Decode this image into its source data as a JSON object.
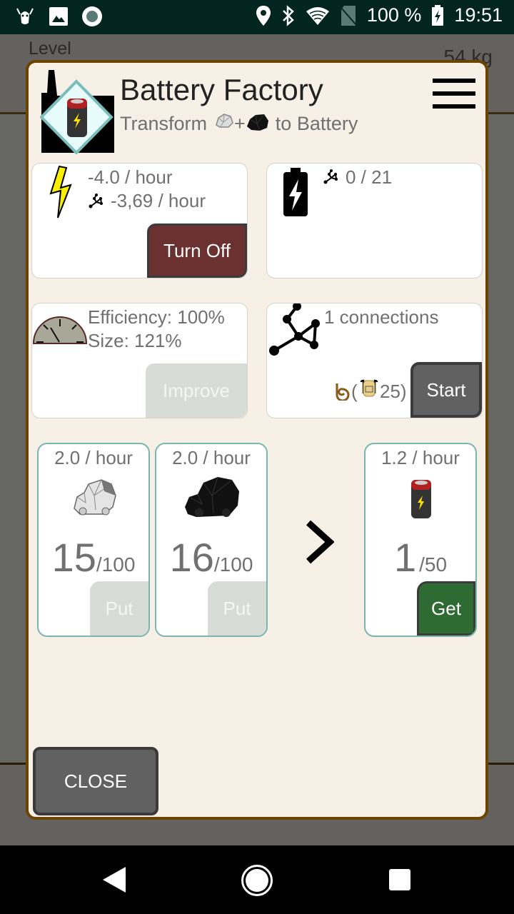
{
  "status_bar": {
    "battery_percent": "100 %",
    "time": "19:51",
    "icons": [
      "bug-icon",
      "image-icon",
      "record-icon",
      "location-icon",
      "bluetooth-icon",
      "wifi-icon",
      "no-sim-icon",
      "battery-charging-icon"
    ]
  },
  "background": {
    "level_label": "Level",
    "weight_label": "54 kg"
  },
  "dialog": {
    "title": "Battery Factory",
    "subtitle": {
      "prefix": "Transform",
      "plus": "+",
      "suffix": "to Battery"
    },
    "menu_icon": "hamburger-menu-icon",
    "power_card": {
      "icon": "lightning-bolt-icon",
      "consumption": "-4.0 / hour",
      "network_consumption": "-3,69 / hour",
      "button_label": "Turn Off"
    },
    "storage_card": {
      "icon": "battery-charging-icon",
      "network_storage": "0 / 21"
    },
    "efficiency_card": {
      "icon": "gauge-icon",
      "efficiency": "Efficiency: 100%",
      "size": "Size: 121%",
      "button_label": "Improve"
    },
    "connections_card": {
      "icon": "network-graph-icon",
      "connections": "1 connections",
      "cost_open": "(",
      "cost_value": "25)",
      "button_label": "Start"
    },
    "inputs": [
      {
        "name": "stone",
        "rate": "2.0 / hour",
        "amount": "15",
        "capacity": "/100",
        "button_label": "Put"
      },
      {
        "name": "coal",
        "rate": "2.0 / hour",
        "amount": "16",
        "capacity": "/100",
        "button_label": "Put"
      }
    ],
    "arrow_icon": "chevron-right-icon",
    "output": {
      "name": "battery",
      "rate": "1.2 / hour",
      "amount": "1",
      "capacity": "/50",
      "button_label": "Get"
    },
    "close_label": "CLOSE"
  },
  "colors": {
    "dialog_bg": "#f6f0e6",
    "dialog_border": "#6b4500",
    "turn_off": "#6b3030",
    "get": "#2e6b33",
    "start": "#616161",
    "disabled": "#d7ddd6",
    "resource_border": "#7bb5b0"
  }
}
